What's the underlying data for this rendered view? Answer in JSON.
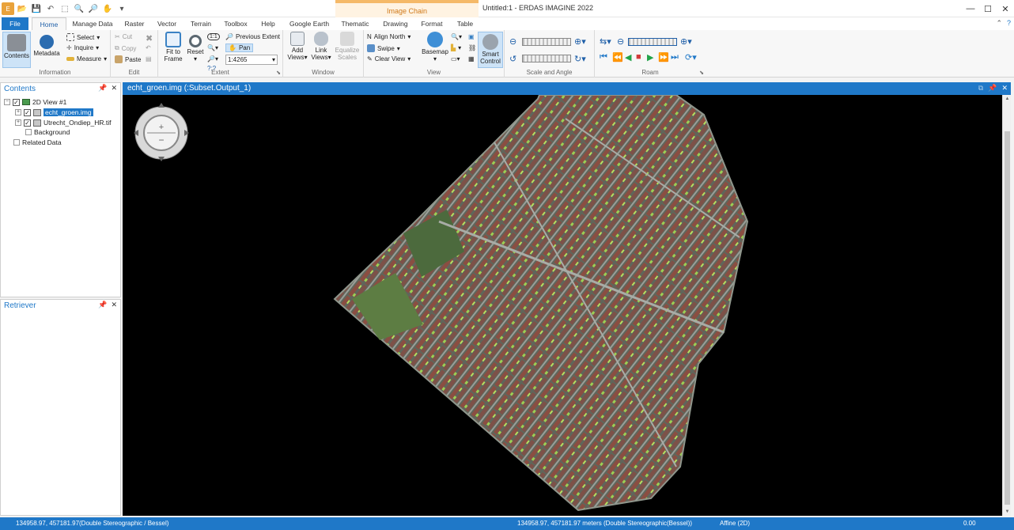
{
  "window": {
    "title": "Untitled:1 - ERDAS IMAGINE 2022",
    "contextual_tab": "Image Chain",
    "controls": [
      "minimize-icon",
      "maximize-icon",
      "close-icon"
    ]
  },
  "tabs": [
    "File",
    "Home",
    "Manage Data",
    "Raster",
    "Vector",
    "Terrain",
    "Toolbox",
    "Help",
    "Google Earth",
    "Thematic",
    "Drawing",
    "Format",
    "Table"
  ],
  "active_tab": "Home",
  "ribbon": {
    "information": {
      "label": "Information",
      "contents": "Contents",
      "metadata": "Metadata",
      "select": "Select",
      "inquire": "Inquire",
      "measure": "Measure"
    },
    "edit": {
      "label": "Edit",
      "cut": "Cut",
      "copy": "Copy",
      "paste": "Paste"
    },
    "extent": {
      "label": "Extent",
      "fit_to_frame_1": "Fit to",
      "fit_to_frame_2": "Frame",
      "reset": "Reset",
      "previous_extent": "Previous Extent",
      "pan": "Pan",
      "scale_value": "1:4265"
    },
    "window": {
      "label": "Window",
      "add_views_1": "Add",
      "add_views_2": "Views",
      "link_views_1": "Link",
      "link_views_2": "Views",
      "equalize_1": "Equalize",
      "equalize_2": "Scales",
      "align_north": "Align North",
      "swipe": "Swipe",
      "clear_view": "Clear View"
    },
    "view": {
      "label": "View",
      "basemap": "Basemap",
      "smart_control_1": "Smart",
      "smart_control_2": "Control"
    },
    "scale_angle": {
      "label": "Scale and Angle"
    },
    "roam": {
      "label": "Roam"
    }
  },
  "contents_panel": {
    "title": "Contents",
    "view_name": "2D View #1",
    "layers": [
      "echt_groen.img",
      "Utrecht_Ondiep_HR.tif"
    ],
    "background": "Background",
    "related": "Related Data"
  },
  "retriever_panel": {
    "title": "Retriever"
  },
  "viewer": {
    "title": "echt_groen.img (:Subset.Output_1)"
  },
  "status": {
    "left_coords": "134958.97, 457181.97",
    "left_proj": "(Double Stereographic / Bessel)",
    "mid": "134958.97, 457181.97 meters (Double Stereographic(Bessel))",
    "transform": "Affine (2D)",
    "value": "0.00"
  }
}
